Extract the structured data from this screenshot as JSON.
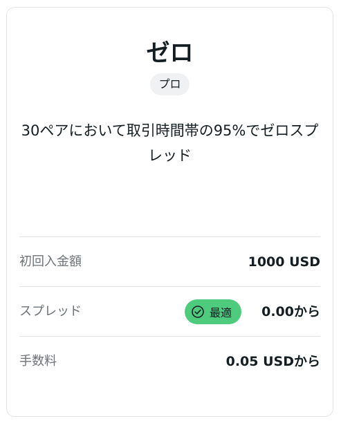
{
  "card": {
    "title": "ゼロ",
    "badge": "プロ",
    "description": "30ペアにおいて取引時間帯の95%でゼロスプレッド"
  },
  "rows": [
    {
      "label": "初回入金額",
      "value": "1000 USD"
    },
    {
      "label": "スプレッド",
      "value": "0.00から",
      "badge": {
        "label": "最適",
        "icon": "check-circle-icon",
        "color": "#4fcb7e"
      }
    },
    {
      "label": "手数料",
      "value": "0.05 USDから"
    }
  ]
}
